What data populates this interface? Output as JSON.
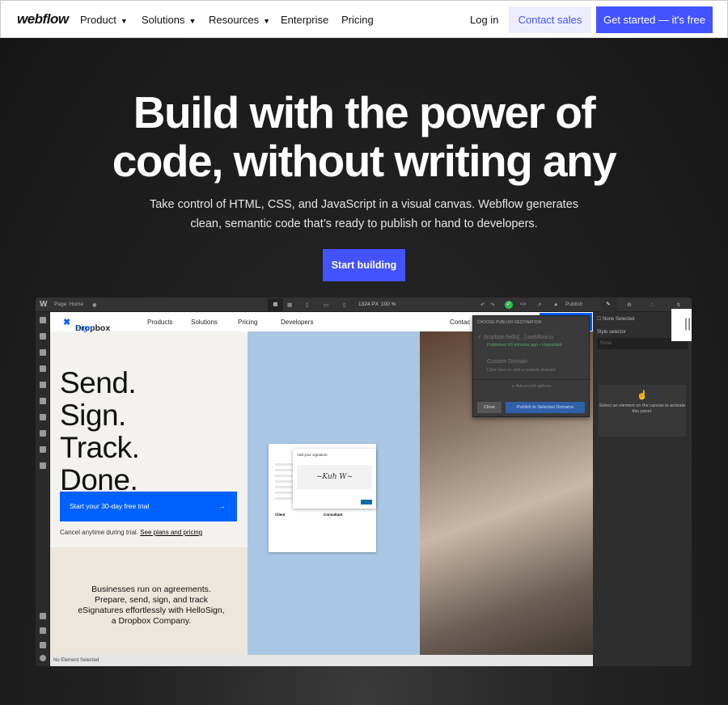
{
  "nav": {
    "logo": "webflow",
    "items": [
      {
        "label": "Product"
      },
      {
        "label": "Solutions"
      },
      {
        "label": "Resources"
      },
      {
        "label": "Enterprise"
      },
      {
        "label": "Pricing"
      }
    ],
    "login": "Log in",
    "contact": "Contact sales",
    "get_started": "Get started — it's free"
  },
  "hero": {
    "title_line1": "Build with the power of",
    "title_line2": "code, without writing any",
    "subtitle_line1": "Take control of HTML, CSS, and JavaScript in a visual canvas. Webflow generates",
    "subtitle_line2": "clean, semantic code that’s ready to publish or hand to developers.",
    "cta": "Start building"
  },
  "designer": {
    "toolbar": {
      "logo": "W",
      "page": "Page: Home",
      "width": "1324 PX",
      "zoom": "100 %",
      "publish": "Publish"
    },
    "canvas": {
      "brand": "Dropbox",
      "brand_accent": "Sign",
      "nav": [
        "Products",
        "Solutions",
        "Pricing",
        "Developers",
        "Contac"
      ],
      "headline": [
        "Send.",
        "Sign.",
        "Track.",
        "Done."
      ],
      "trial": "Start your 30-day free trial",
      "cancel": "Cancel anytime during trial.",
      "plans": "See plans and pricing",
      "business": "Businesses run on agreements. Prepare, send, sign, and track eSignatures effortlessly with HelloSign, a Dropbox Company.",
      "doc_title": "Add your signature",
      "doc_client": "Client",
      "doc_consultant": "Consultant"
    },
    "publish_dialog": {
      "heading": "CHOOSE PUBLISH DESTINATION",
      "domain": "dropbox-hello[...].webflow.io",
      "published": "Published 43 minutes ago",
      "unpublish": "Unpublish",
      "custom": "Custom Domain",
      "custom_hint": "Click here to add a custom domain",
      "advanced": "Advanced options",
      "close": "Close",
      "publish_btn": "Publish to Selected Domains"
    },
    "right_panel": {
      "none_selected": "None Selected",
      "style_selector": "Style selector",
      "none": "None",
      "hint": "Select an element on the canvas to activate this panel."
    },
    "status": "No Element Selected"
  },
  "colors": {
    "accent": "#4353ff",
    "dropbox_blue": "#0061fe"
  }
}
